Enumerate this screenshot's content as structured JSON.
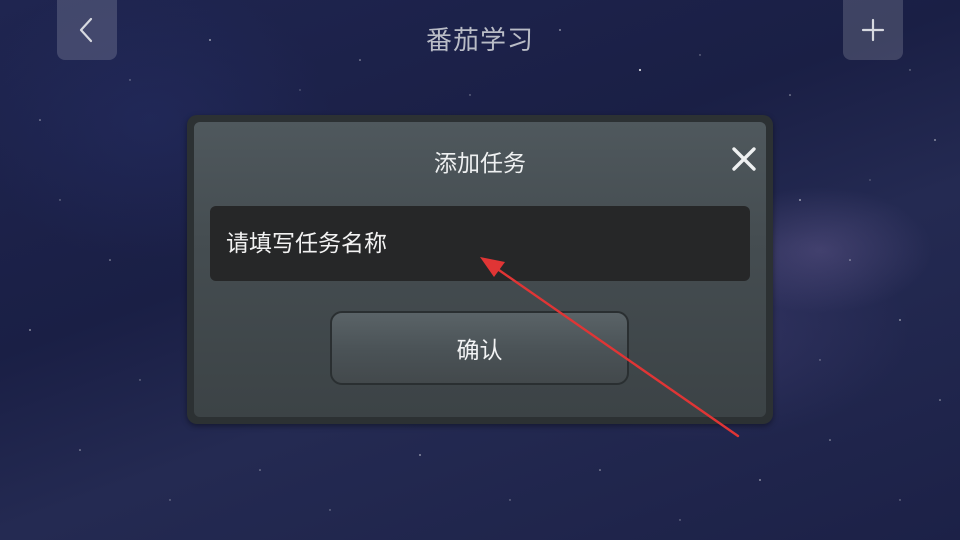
{
  "header": {
    "title": "番茄学习",
    "back_icon": "chevron-left-icon",
    "add_icon": "plus-icon"
  },
  "dialog": {
    "title": "添加任务",
    "close_icon": "close-icon",
    "input_placeholder": "请填写任务名称",
    "confirm_label": "确认"
  },
  "annotation": {
    "arrow_color": "#e03535"
  }
}
